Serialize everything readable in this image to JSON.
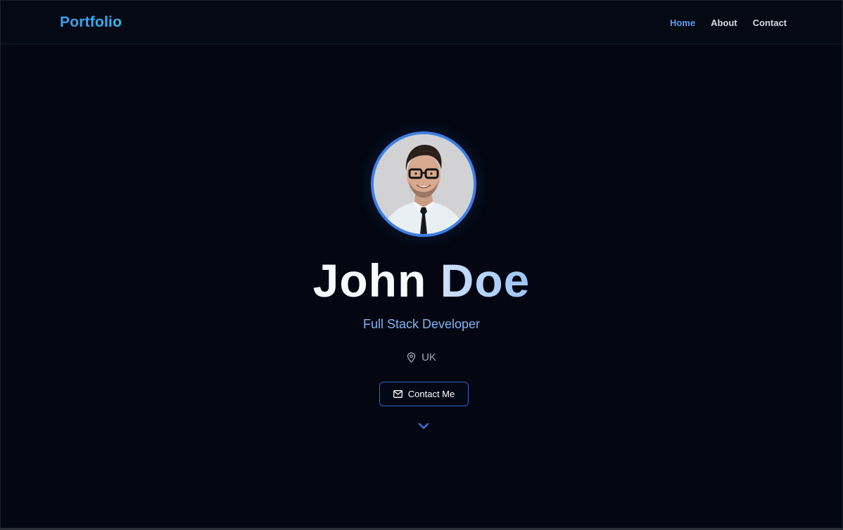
{
  "navbar": {
    "brand": "Portfolio",
    "links": [
      {
        "label": "Home",
        "active": true
      },
      {
        "label": "About",
        "active": false
      },
      {
        "label": "Contact",
        "active": false
      }
    ]
  },
  "hero": {
    "first_name": "John",
    "last_name": "Doe",
    "role": "Full Stack Developer",
    "location": "UK",
    "contact_button": "Contact Me"
  },
  "icons": {
    "location": "map-pin-icon",
    "contact": "mail-icon",
    "scroll": "chevron-down-icon"
  },
  "colors": {
    "background": "#030712",
    "accent": "#3b82f6",
    "brand": "#3aa7f0",
    "nav_active": "#5b9ef3",
    "role_text": "#7eb4f4"
  }
}
